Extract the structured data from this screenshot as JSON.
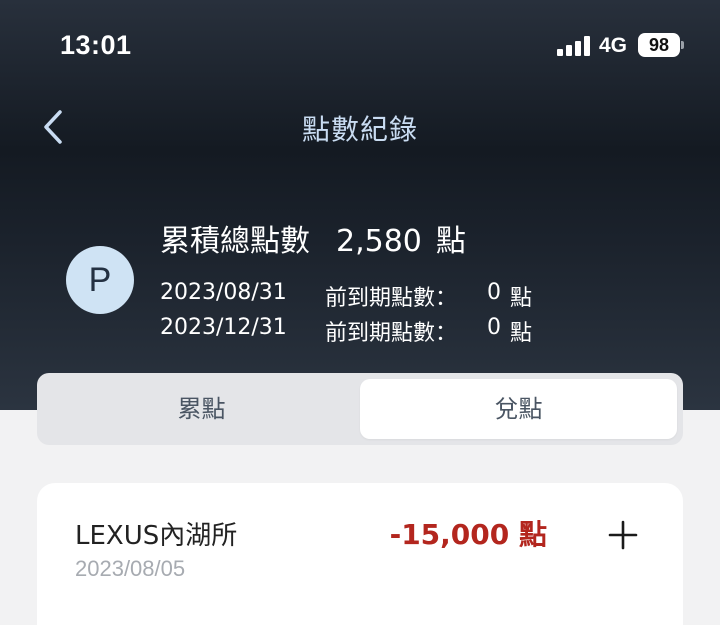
{
  "status_bar": {
    "time": "13:01",
    "signal_icon": "signal-bars-icon",
    "network": "4G",
    "battery": "98"
  },
  "header": {
    "back_icon": "chevron-left-icon",
    "title": "點數紀錄"
  },
  "summary": {
    "avatar_letter": "P",
    "total_label": "累積總點數",
    "total_value": "2,580",
    "total_unit": "點",
    "expiries": [
      {
        "date": "2023/08/31",
        "label": "前到期點數：",
        "value": "0",
        "unit": "點"
      },
      {
        "date": "2023/12/31",
        "label": "前到期點數：",
        "value": "0",
        "unit": "點"
      }
    ]
  },
  "tabs": [
    {
      "label": "累點",
      "selected": false
    },
    {
      "label": "兌點",
      "selected": true
    }
  ],
  "records": [
    {
      "location": "LEXUS內湖所",
      "date": "2023/08/05",
      "points": "-15,000 點",
      "points_color": "#b3261e",
      "expand_icon": "plus-icon"
    }
  ],
  "colors": {
    "accent_title": "#c9dcf2",
    "avatar_bg": "#cfe3f4",
    "negative_points": "#b3261e"
  }
}
